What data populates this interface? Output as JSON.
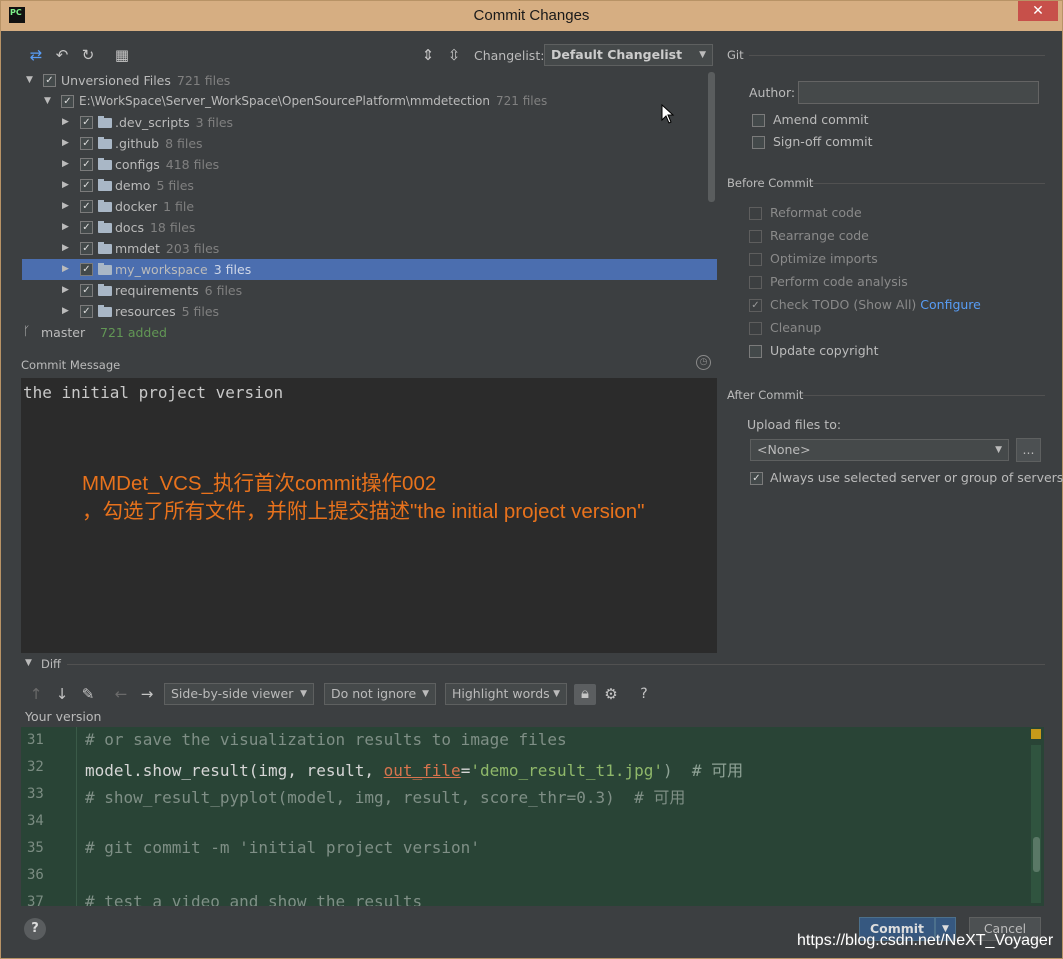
{
  "window": {
    "title": "Commit Changes",
    "app_icon": "PC"
  },
  "toolbar": {
    "changelist_label": "Changelist:",
    "changelist_value": "Default Changelist"
  },
  "tree": {
    "root": {
      "label": "Unversioned Files",
      "count": "721 files"
    },
    "path": {
      "label": "E:\\WorkSpace\\Server_WorkSpace\\OpenSourcePlatform\\mmdetection",
      "count": "721 files"
    },
    "folders": [
      {
        "label": ".dev_scripts",
        "count": "3 files"
      },
      {
        "label": ".github",
        "count": "8 files"
      },
      {
        "label": "configs",
        "count": "418 files"
      },
      {
        "label": "demo",
        "count": "5 files"
      },
      {
        "label": "docker",
        "count": "1 file"
      },
      {
        "label": "docs",
        "count": "18 files"
      },
      {
        "label": "mmdet",
        "count": "203 files"
      },
      {
        "label": "my_workspace",
        "count": "3 files"
      },
      {
        "label": "requirements",
        "count": "6 files"
      },
      {
        "label": "resources",
        "count": "5 files"
      }
    ]
  },
  "status": {
    "branch": "master",
    "added": "721 added"
  },
  "commit_message": {
    "label": "Commit Message",
    "text": "the initial project version",
    "annotation_line1": "MMDet_VCS_执行首次commit操作002",
    "annotation_line2": "，勾选了所有文件，并附上提交描述\"the initial project version\""
  },
  "git": {
    "section": "Git",
    "author_label": "Author:",
    "author_value": "",
    "amend": "Amend commit",
    "signoff": "Sign-off commit"
  },
  "before_commit": {
    "section": "Before Commit",
    "reformat": "Reformat code",
    "rearrange": "Rearrange code",
    "optimize": "Optimize imports",
    "analysis": "Perform code analysis",
    "todo": "Check TODO (Show All)",
    "configure": "Configure",
    "cleanup": "Cleanup",
    "copyright": "Update copyright"
  },
  "after_commit": {
    "section": "After Commit",
    "upload_label": "Upload files to:",
    "upload_value": "<None>",
    "more": "...",
    "always": "Always use selected server or group of servers"
  },
  "diff": {
    "label": "Diff",
    "viewer": "Side-by-side viewer",
    "ignore": "Do not ignore",
    "highlight": "Highlight words",
    "help": "?",
    "your_version": "Your version",
    "lines": [
      {
        "n": "31"
      },
      {
        "n": "32"
      },
      {
        "n": "33"
      },
      {
        "n": "34"
      },
      {
        "n": "35"
      },
      {
        "n": "36"
      },
      {
        "n": "37"
      }
    ],
    "code": {
      "l31": "# or save the visualization results to image files",
      "l32_a": "model.show_result(img, result, ",
      "l32_b": "out_file",
      "l32_c": "=",
      "l32_d": "'demo_result_t1.jpg'",
      "l32_e": ")  # 可用",
      "l33": "# show_result_pyplot(model, img, result, score_thr=0.3)  # 可用",
      "l35": "# git commit -m 'initial project version'",
      "l37": "# test a video and show the results"
    }
  },
  "buttons": {
    "commit": "Commit",
    "cancel": "Cancel",
    "help": "?"
  },
  "watermark": "https://blog.csdn.net/NeXT_Voyager",
  "colors": {
    "accent": "#4b6eaf",
    "link": "#589df6",
    "annotation": "#e8721c",
    "editor_bg": "#294436"
  }
}
